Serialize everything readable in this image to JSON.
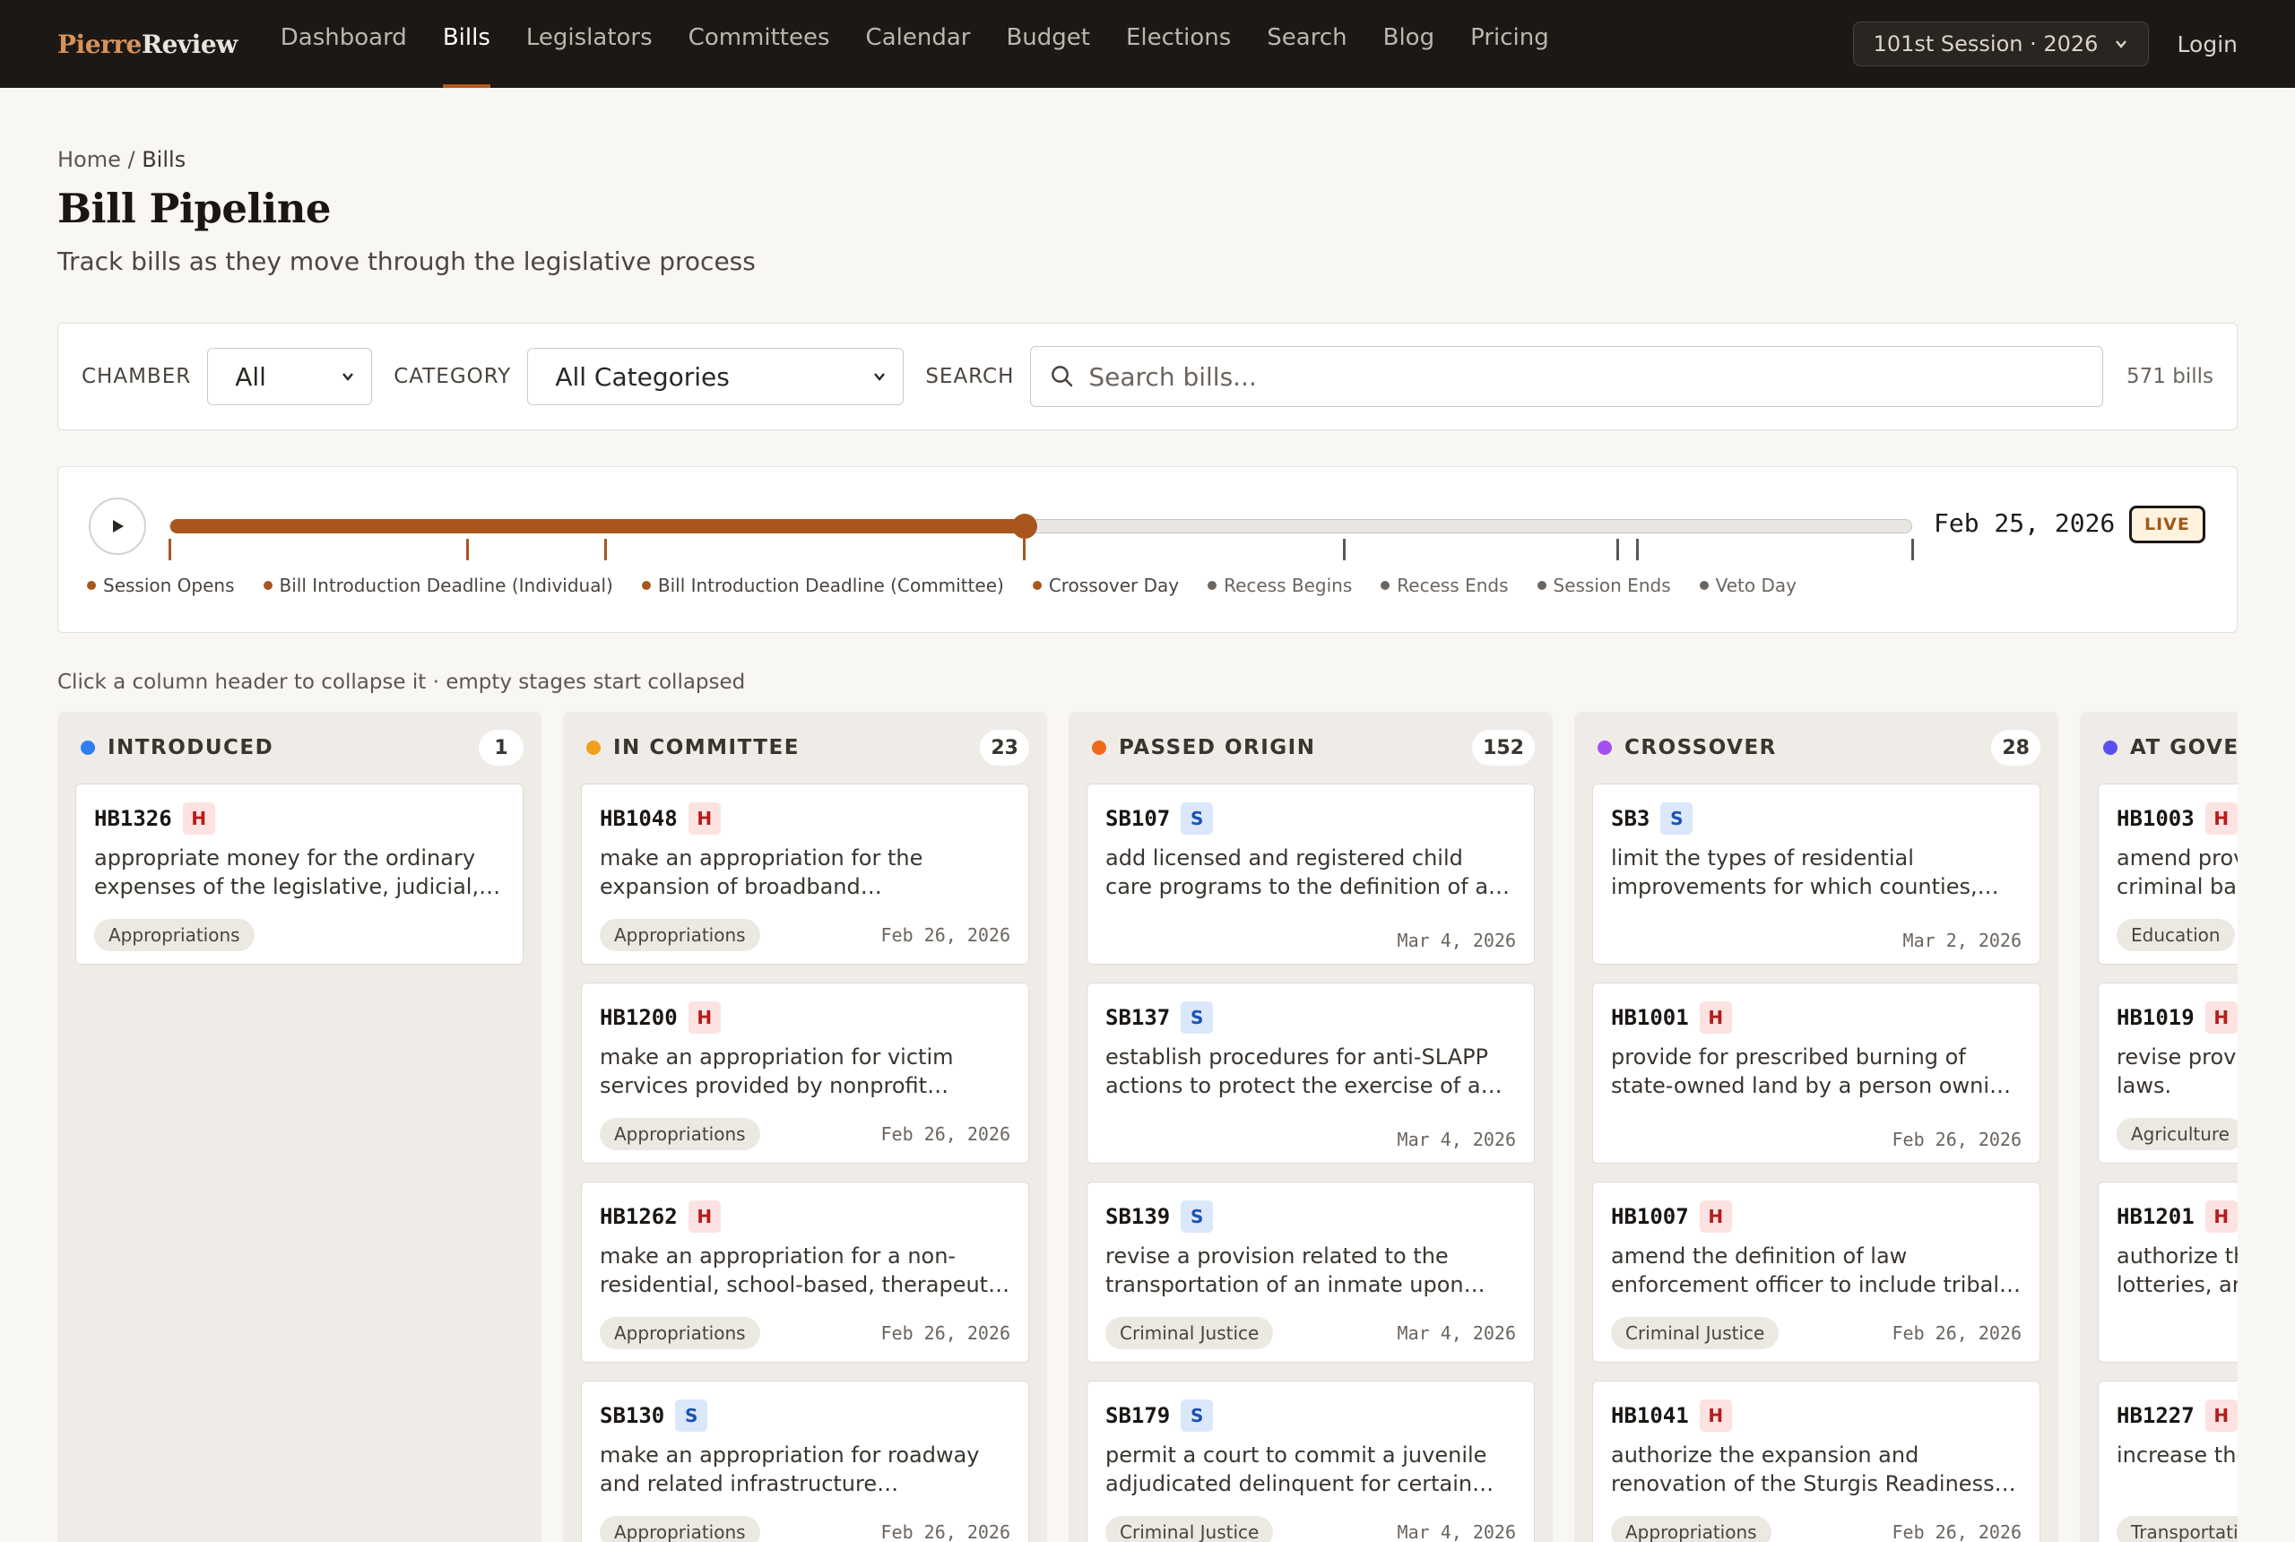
{
  "brand": {
    "part1": "Pierre",
    "part2": "Review"
  },
  "nav": {
    "items": [
      {
        "label": "Dashboard",
        "active": false
      },
      {
        "label": "Bills",
        "active": true
      },
      {
        "label": "Legislators",
        "active": false
      },
      {
        "label": "Committees",
        "active": false
      },
      {
        "label": "Calendar",
        "active": false
      },
      {
        "label": "Budget",
        "active": false
      },
      {
        "label": "Elections",
        "active": false
      },
      {
        "label": "Search",
        "active": false
      },
      {
        "label": "Blog",
        "active": false
      },
      {
        "label": "Pricing",
        "active": false
      }
    ],
    "session": "101st Session · 2026",
    "login": "Login"
  },
  "breadcrumb": {
    "home": "Home",
    "sep": " / ",
    "current": "Bills"
  },
  "title": "Bill Pipeline",
  "subtitle": "Track bills as they move through the legislative process",
  "filters": {
    "chamber_label": "CHAMBER",
    "chamber_value": "All",
    "category_label": "CATEGORY",
    "category_value": "All Categories",
    "search_label": "SEARCH",
    "search_placeholder": "Search bills...",
    "count": "571 bills"
  },
  "timeline": {
    "date": "Feb 25, 2026",
    "live": "LIVE",
    "progress": 0.49,
    "ticks": [
      {
        "at": 0.0,
        "past": true
      },
      {
        "at": 0.171,
        "past": true
      },
      {
        "at": 0.25,
        "past": true
      },
      {
        "at": 0.49,
        "past": true
      },
      {
        "at": 0.674,
        "past": false
      },
      {
        "at": 0.831,
        "past": false
      },
      {
        "at": 0.842,
        "past": false
      },
      {
        "at": 1.0,
        "past": false
      }
    ],
    "legend": [
      {
        "label": "Session Opens",
        "past": true
      },
      {
        "label": "Bill Introduction Deadline (Individual)",
        "past": true
      },
      {
        "label": "Bill Introduction Deadline (Committee)",
        "past": true
      },
      {
        "label": "Crossover Day",
        "past": true
      },
      {
        "label": "Recess Begins",
        "past": false
      },
      {
        "label": "Recess Ends",
        "past": false
      },
      {
        "label": "Session Ends",
        "past": false
      },
      {
        "label": "Veto Day",
        "past": false
      }
    ]
  },
  "hint": "Click a column header to collapse it · empty stages start collapsed",
  "columns": [
    {
      "title": "INTRODUCED",
      "count": "1",
      "color": "#2f7ff0",
      "cards": [
        {
          "id": "HB1326",
          "chamber": "H",
          "desc": "appropriate money for the ordinary expenses of the legislative, judicial, and executive departments",
          "category": "Appropriations",
          "date": ""
        }
      ]
    },
    {
      "title": "IN COMMITTEE",
      "count": "23",
      "color": "#f0a11c",
      "cards": [
        {
          "id": "HB1048",
          "chamber": "H",
          "desc": "make an appropriation for the expansion of broadband infrastructure",
          "category": "Appropriations",
          "date": "Feb 26, 2026"
        },
        {
          "id": "HB1200",
          "chamber": "H",
          "desc": "make an appropriation for victim services provided by nonprofit organizations",
          "category": "Appropriations",
          "date": "Feb 26, 2026"
        },
        {
          "id": "HB1262",
          "chamber": "H",
          "desc": "make an appropriation for a non-residential, school-based, therapeutic program",
          "category": "Appropriations",
          "date": "Feb 26, 2026"
        },
        {
          "id": "SB130",
          "chamber": "S",
          "desc": "make an appropriation for roadway and related infrastructure improvements",
          "category": "Appropriations",
          "date": "Feb 26, 2026"
        }
      ]
    },
    {
      "title": "PASSED ORIGIN",
      "count": "152",
      "color": "#f06a1c",
      "cards": [
        {
          "id": "SB107",
          "chamber": "S",
          "desc": "add licensed and registered child care programs to the definition of a protected setting",
          "category": "",
          "date": "Mar 4, 2026"
        },
        {
          "id": "SB137",
          "chamber": "S",
          "desc": "establish procedures for anti-SLAPP actions to protect the exercise of a constitutional right",
          "category": "",
          "date": "Mar 4, 2026"
        },
        {
          "id": "SB139",
          "chamber": "S",
          "desc": "revise a provision related to the transportation of an inmate upon release",
          "category": "Criminal Justice",
          "date": "Mar 4, 2026"
        },
        {
          "id": "SB179",
          "chamber": "S",
          "desc": "permit a court to commit a juvenile adjudicated delinquent for certain offenses",
          "category": "Criminal Justice",
          "date": "Mar 4, 2026"
        }
      ]
    },
    {
      "title": "CROSSOVER",
      "count": "28",
      "color": "#a44ff0",
      "cards": [
        {
          "id": "SB3",
          "chamber": "S",
          "desc": "limit the types of residential improvements for which counties, municipalities may require permits",
          "category": "",
          "date": "Mar 2, 2026"
        },
        {
          "id": "HB1001",
          "chamber": "H",
          "desc": "provide for prescribed burning of state-owned land by a person owning adjacent land",
          "category": "",
          "date": "Feb 26, 2026"
        },
        {
          "id": "HB1007",
          "chamber": "H",
          "desc": "amend the definition of law enforcement officer to include tribal law enforcement",
          "category": "Criminal Justice",
          "date": "Feb 26, 2026"
        },
        {
          "id": "HB1041",
          "chamber": "H",
          "desc": "authorize the expansion and renovation of the Sturgis Readiness Center",
          "category": "Appropriations",
          "date": "Feb 26, 2026"
        }
      ]
    },
    {
      "title": "AT GOVERNOR",
      "count": "",
      "color": "#5b4ff0",
      "cards": [
        {
          "id": "HB1003",
          "chamber": "H",
          "desc": "amend provisions regarding required criminal background checks",
          "category": "Education",
          "date": ""
        },
        {
          "id": "HB1019",
          "chamber": "H",
          "desc": "revise provisions regarding certain laws.",
          "category": "Agriculture",
          "date": ""
        },
        {
          "id": "HB1201",
          "chamber": "H",
          "desc": "authorize the state to conduct lotteries, and",
          "category": "",
          "date": ""
        },
        {
          "id": "HB1227",
          "chamber": "H",
          "desc": "increase the penalty for an owner of",
          "category": "Transportation",
          "date": ""
        }
      ]
    }
  ]
}
